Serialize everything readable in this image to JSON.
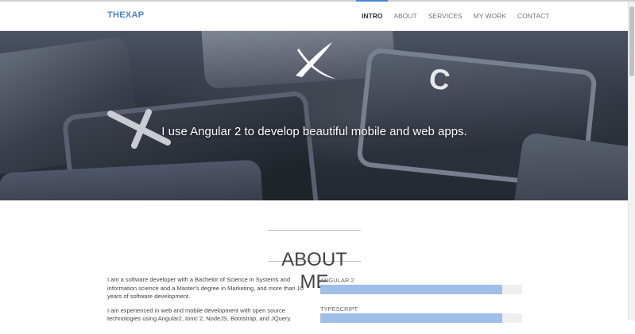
{
  "navbar": {
    "brand": "THEXAP",
    "items": [
      {
        "label": "INTRO",
        "active": true
      },
      {
        "label": "ABOUT",
        "active": false
      },
      {
        "label": "SERVICES",
        "active": false
      },
      {
        "label": "MY WORK",
        "active": false
      },
      {
        "label": "CONTACT",
        "active": false
      }
    ]
  },
  "hero": {
    "tagline": "I use Angular 2 to develop beautiful mobile and web apps.",
    "key_glyph": "C"
  },
  "about": {
    "title": "ABOUT ME",
    "paragraphs": [
      "I am a software developer with a Bachelor of Science in Systems and information science and a Master's degree in Marketing, and more than 10 years of software development.",
      "I am experienced in web and mobile development with open source technologies using Angular2, Ionic 2, NodeJS, Bootstrap, and JQuery."
    ],
    "skills": [
      {
        "label": "ANGULAR 2",
        "level": 0.9
      },
      {
        "label": "TYPESCRIPT",
        "level": 0.9
      }
    ]
  },
  "colors": {
    "accent": "#4a86d0",
    "skill_fill": "#9fbfe8",
    "skill_track": "#efefef"
  }
}
